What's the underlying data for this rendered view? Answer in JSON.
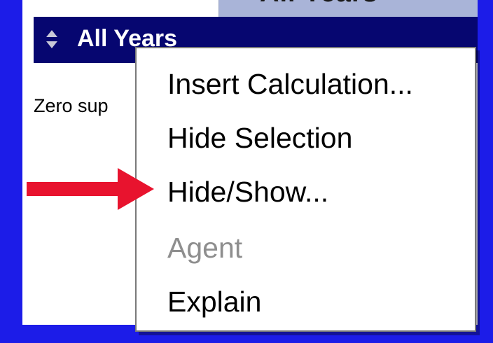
{
  "header": {
    "title": "All Years",
    "sort_icon": "sort-updown-icon"
  },
  "body": {
    "label_fragment": "Zero sup"
  },
  "top_strip": {
    "clipped_text": "All Years"
  },
  "context_menu": {
    "items": [
      {
        "label": "Insert Calculation...",
        "enabled": true
      },
      {
        "label": "Hide Selection",
        "enabled": true
      },
      {
        "label": "Hide/Show...",
        "enabled": true
      },
      {
        "label": "Agent",
        "enabled": false
      },
      {
        "label": "Explain",
        "enabled": true
      }
    ]
  },
  "annotation": {
    "arrow_icon": "red-arrow-icon",
    "arrow_color": "#e8132e"
  },
  "colors": {
    "frame": "#1c1ce8",
    "header_bar": "#060670",
    "disabled_text": "#8e8e8e"
  }
}
